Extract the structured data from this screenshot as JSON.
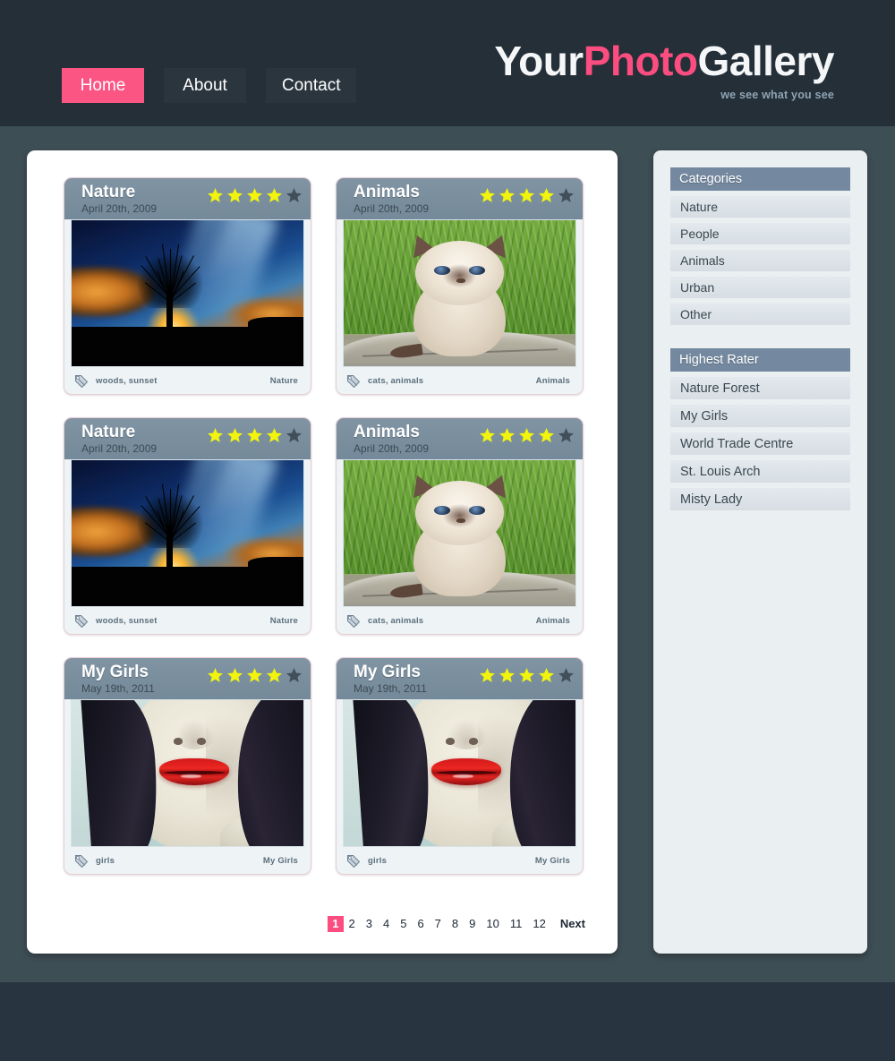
{
  "site": {
    "brand_part1": "Your",
    "brand_part2": "Photo",
    "brand_part3": "Gallery",
    "tagline": "we see what you see",
    "accent_color": "#fb4d7f",
    "header_bg": "#242f38",
    "page_bg": "#3e4e55",
    "footer_bg": "#283440"
  },
  "nav": {
    "items": [
      {
        "label": "Home",
        "active": true
      },
      {
        "label": "About",
        "active": false
      },
      {
        "label": "Contact",
        "active": false
      }
    ]
  },
  "gallery": {
    "cards": [
      {
        "title": "Nature",
        "date": "April 20th, 2009",
        "rating": 4,
        "max_rating": 5,
        "tags": "woods, sunset",
        "category": "Nature",
        "photo": "sunset-tree-photo",
        "tag_icon": "tag-icon"
      },
      {
        "title": "Animals",
        "date": "April 20th, 2009",
        "rating": 4,
        "max_rating": 5,
        "tags": "cats, animals",
        "category": "Animals",
        "photo": "kitten-grass-photo",
        "tag_icon": "tag-icon"
      },
      {
        "title": "Nature",
        "date": "April 20th, 2009",
        "rating": 4,
        "max_rating": 5,
        "tags": "woods, sunset",
        "category": "Nature",
        "photo": "sunset-tree-photo",
        "tag_icon": "tag-icon"
      },
      {
        "title": "Animals",
        "date": "April 20th, 2009",
        "rating": 4,
        "max_rating": 5,
        "tags": "cats, animals",
        "category": "Animals",
        "photo": "kitten-grass-photo",
        "tag_icon": "tag-icon"
      },
      {
        "title": "My Girls",
        "date": "May 19th, 2011",
        "rating": 4,
        "max_rating": 5,
        "tags": "girls",
        "category": "My Girls",
        "photo": "red-lips-girl-photo",
        "tag_icon": "tag-icon"
      },
      {
        "title": "My Girls",
        "date": "May 19th, 2011",
        "rating": 4,
        "max_rating": 5,
        "tags": "girls",
        "category": "My Girls",
        "photo": "red-lips-girl-photo",
        "tag_icon": "tag-icon"
      }
    ]
  },
  "pagination": {
    "current": "1",
    "pages": [
      "1",
      "2",
      "3",
      "4",
      "5",
      "6",
      "7",
      "8",
      "9",
      "10",
      "11",
      "12"
    ],
    "next_label": "Next"
  },
  "sidebar": {
    "categories": {
      "heading": "Categories",
      "items": [
        "Nature",
        "People",
        "Animals",
        "Urban",
        "Other"
      ]
    },
    "highest_rater": {
      "heading": "Highest Rater",
      "items": [
        "Nature  Forest",
        "My Girls",
        "World Trade Centre",
        "St. Louis Arch",
        "Misty Lady"
      ]
    }
  },
  "colors": {
    "star_filled": "#f2f40c",
    "star_empty": "#414f5a",
    "card_header": "#7489a0",
    "panel_heading_bg": "#7489a0",
    "sidebar_bg": "#eaeff2"
  }
}
